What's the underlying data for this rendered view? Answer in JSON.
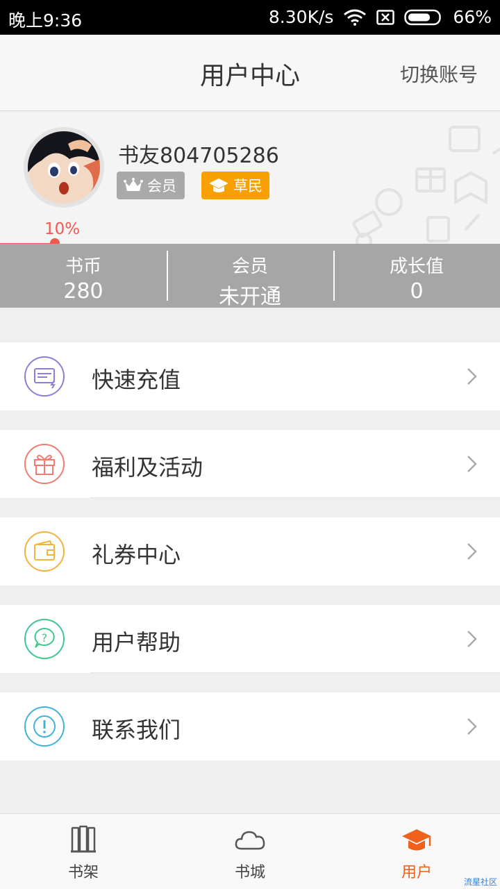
{
  "status_bar": {
    "time": "晚上9:36",
    "speed": "8.30K/s",
    "battery": "66%"
  },
  "header": {
    "title": "用户中心",
    "switch_account": "切换账号"
  },
  "profile": {
    "username": "书友804705286",
    "vip_badge": "会员",
    "level_badge": "草民",
    "progress_percent": "10%",
    "progress_value": 0.1
  },
  "stats": [
    {
      "label": "书币",
      "value": "280"
    },
    {
      "label": "会员",
      "value": "未开通"
    },
    {
      "label": "成长值",
      "value": "0"
    }
  ],
  "menu": [
    {
      "label": "快速充值",
      "icon": "recharge-card-icon",
      "color": "#8c7fd6"
    },
    {
      "label": "福利及活动",
      "icon": "gift-icon",
      "color": "#ef7b72"
    },
    {
      "label": "礼券中心",
      "icon": "wallet-icon",
      "color": "#f3b33b"
    },
    {
      "label": "用户帮助",
      "icon": "help-bubble-icon",
      "color": "#3fc58d"
    },
    {
      "label": "联系我们",
      "icon": "info-exclamation-icon",
      "color": "#3fb3d8"
    }
  ],
  "tabs": [
    {
      "label": "书架",
      "icon": "bookshelf-icon",
      "active": false
    },
    {
      "label": "书城",
      "icon": "cloud-icon",
      "active": false
    },
    {
      "label": "用户",
      "icon": "graduation-cap-icon",
      "active": true
    }
  ],
  "colors": {
    "accent": "#f0611c",
    "progress": "#f05a50",
    "level_badge": "#f7a000",
    "vip_badge": "#a9a9a9",
    "stats_bg": "#a6a6a6"
  },
  "watermark": "流星社区"
}
